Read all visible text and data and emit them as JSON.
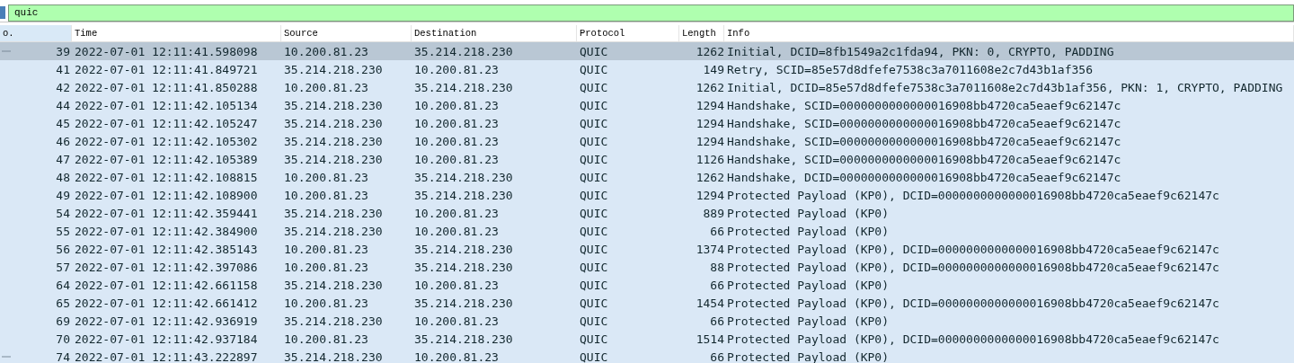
{
  "filter": {
    "value": "quic"
  },
  "columns": [
    "o.",
    "Time",
    "Source",
    "Destination",
    "Protocol",
    "Length",
    "Info"
  ],
  "rows": [
    {
      "no": "39",
      "time": "2022-07-01 12:11:41.598098",
      "source": "10.200.81.23",
      "destination": "35.214.218.230",
      "protocol": "QUIC",
      "length": "1262",
      "info": "Initial, DCID=8fb1549a2c1fda94, PKN: 0, CRYPTO, PADDING",
      "selected": true,
      "related": true
    },
    {
      "no": "41",
      "time": "2022-07-01 12:11:41.849721",
      "source": "35.214.218.230",
      "destination": "10.200.81.23",
      "protocol": "QUIC",
      "length": "149",
      "info": "Retry, SCID=85e57d8dfefe7538c3a7011608e2c7d43b1af356",
      "selected": false,
      "related": false
    },
    {
      "no": "42",
      "time": "2022-07-01 12:11:41.850288",
      "source": "10.200.81.23",
      "destination": "35.214.218.230",
      "protocol": "QUIC",
      "length": "1262",
      "info": "Initial, DCID=85e57d8dfefe7538c3a7011608e2c7d43b1af356, PKN: 1, CRYPTO, PADDING",
      "selected": false,
      "related": false
    },
    {
      "no": "44",
      "time": "2022-07-01 12:11:42.105134",
      "source": "35.214.218.230",
      "destination": "10.200.81.23",
      "protocol": "QUIC",
      "length": "1294",
      "info": "Handshake, SCID=0000000000000016908bb4720ca5eaef9c62147c",
      "selected": false,
      "related": false
    },
    {
      "no": "45",
      "time": "2022-07-01 12:11:42.105247",
      "source": "35.214.218.230",
      "destination": "10.200.81.23",
      "protocol": "QUIC",
      "length": "1294",
      "info": "Handshake, SCID=0000000000000016908bb4720ca5eaef9c62147c",
      "selected": false,
      "related": false
    },
    {
      "no": "46",
      "time": "2022-07-01 12:11:42.105302",
      "source": "35.214.218.230",
      "destination": "10.200.81.23",
      "protocol": "QUIC",
      "length": "1294",
      "info": "Handshake, SCID=0000000000000016908bb4720ca5eaef9c62147c",
      "selected": false,
      "related": false
    },
    {
      "no": "47",
      "time": "2022-07-01 12:11:42.105389",
      "source": "35.214.218.230",
      "destination": "10.200.81.23",
      "protocol": "QUIC",
      "length": "1126",
      "info": "Handshake, SCID=0000000000000016908bb4720ca5eaef9c62147c",
      "selected": false,
      "related": false
    },
    {
      "no": "48",
      "time": "2022-07-01 12:11:42.108815",
      "source": "10.200.81.23",
      "destination": "35.214.218.230",
      "protocol": "QUIC",
      "length": "1262",
      "info": "Handshake, DCID=0000000000000016908bb4720ca5eaef9c62147c",
      "selected": false,
      "related": false
    },
    {
      "no": "49",
      "time": "2022-07-01 12:11:42.108900",
      "source": "10.200.81.23",
      "destination": "35.214.218.230",
      "protocol": "QUIC",
      "length": "1294",
      "info": "Protected Payload (KP0), DCID=0000000000000016908bb4720ca5eaef9c62147c",
      "selected": false,
      "related": false
    },
    {
      "no": "54",
      "time": "2022-07-01 12:11:42.359441",
      "source": "35.214.218.230",
      "destination": "10.200.81.23",
      "protocol": "QUIC",
      "length": "889",
      "info": "Protected Payload (KP0)",
      "selected": false,
      "related": false
    },
    {
      "no": "55",
      "time": "2022-07-01 12:11:42.384900",
      "source": "35.214.218.230",
      "destination": "10.200.81.23",
      "protocol": "QUIC",
      "length": "66",
      "info": "Protected Payload (KP0)",
      "selected": false,
      "related": false
    },
    {
      "no": "56",
      "time": "2022-07-01 12:11:42.385143",
      "source": "10.200.81.23",
      "destination": "35.214.218.230",
      "protocol": "QUIC",
      "length": "1374",
      "info": "Protected Payload (KP0), DCID=0000000000000016908bb4720ca5eaef9c62147c",
      "selected": false,
      "related": false
    },
    {
      "no": "57",
      "time": "2022-07-01 12:11:42.397086",
      "source": "10.200.81.23",
      "destination": "35.214.218.230",
      "protocol": "QUIC",
      "length": "88",
      "info": "Protected Payload (KP0), DCID=0000000000000016908bb4720ca5eaef9c62147c",
      "selected": false,
      "related": false
    },
    {
      "no": "64",
      "time": "2022-07-01 12:11:42.661158",
      "source": "35.214.218.230",
      "destination": "10.200.81.23",
      "protocol": "QUIC",
      "length": "66",
      "info": "Protected Payload (KP0)",
      "selected": false,
      "related": false
    },
    {
      "no": "65",
      "time": "2022-07-01 12:11:42.661412",
      "source": "10.200.81.23",
      "destination": "35.214.218.230",
      "protocol": "QUIC",
      "length": "1454",
      "info": "Protected Payload (KP0), DCID=0000000000000016908bb4720ca5eaef9c62147c",
      "selected": false,
      "related": false
    },
    {
      "no": "69",
      "time": "2022-07-01 12:11:42.936919",
      "source": "35.214.218.230",
      "destination": "10.200.81.23",
      "protocol": "QUIC",
      "length": "66",
      "info": "Protected Payload (KP0)",
      "selected": false,
      "related": false
    },
    {
      "no": "70",
      "time": "2022-07-01 12:11:42.937184",
      "source": "10.200.81.23",
      "destination": "35.214.218.230",
      "protocol": "QUIC",
      "length": "1514",
      "info": "Protected Payload (KP0), DCID=0000000000000016908bb4720ca5eaef9c62147c",
      "selected": false,
      "related": false
    },
    {
      "no": "74",
      "time": "2022-07-01 12:11:43.222897",
      "source": "35.214.218.230",
      "destination": "10.200.81.23",
      "protocol": "QUIC",
      "length": "66",
      "info": "Protected Payload (KP0)",
      "selected": false,
      "related": true
    }
  ]
}
